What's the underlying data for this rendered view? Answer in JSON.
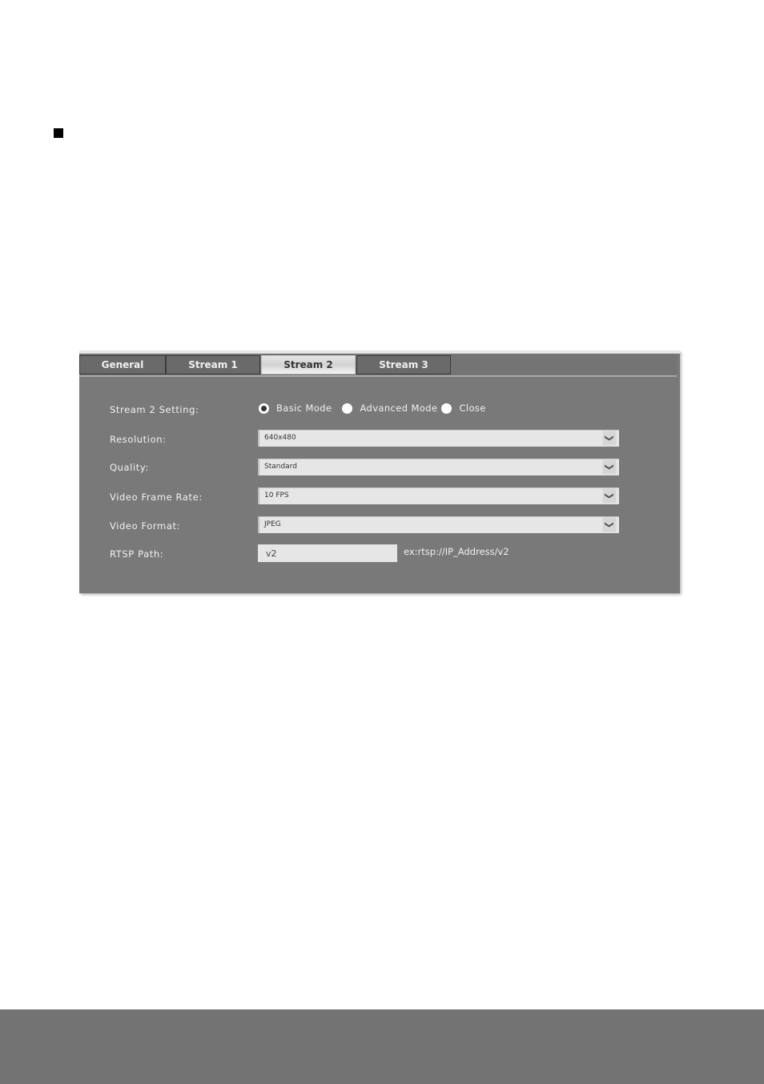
{
  "tabs": [
    {
      "label": "General",
      "active": false
    },
    {
      "label": "Stream 1",
      "active": false
    },
    {
      "label": "Stream 2",
      "active": true
    },
    {
      "label": "Stream 3",
      "active": false
    }
  ],
  "form": {
    "stream_setting": {
      "label": "Stream 2 Setting:",
      "options": [
        {
          "label": "Basic Mode",
          "checked": true
        },
        {
          "label": "Advanced Mode",
          "checked": false
        },
        {
          "label": "Close",
          "checked": false
        }
      ]
    },
    "resolution": {
      "label": "Resolution:",
      "value": "640x480"
    },
    "quality": {
      "label": "Quality:",
      "value": "Standard"
    },
    "frame_rate": {
      "label": "Video Frame Rate:",
      "value": "10 FPS"
    },
    "video_format": {
      "label": "Video Format:",
      "value": "JPEG"
    },
    "rtsp_path": {
      "label": "RTSP Path:",
      "value": "v2",
      "hint": "ex:rtsp://IP_Address/v2"
    }
  },
  "icons": {
    "dropdown": "chevron-down-icon",
    "bullet": "square-bullet-icon"
  }
}
